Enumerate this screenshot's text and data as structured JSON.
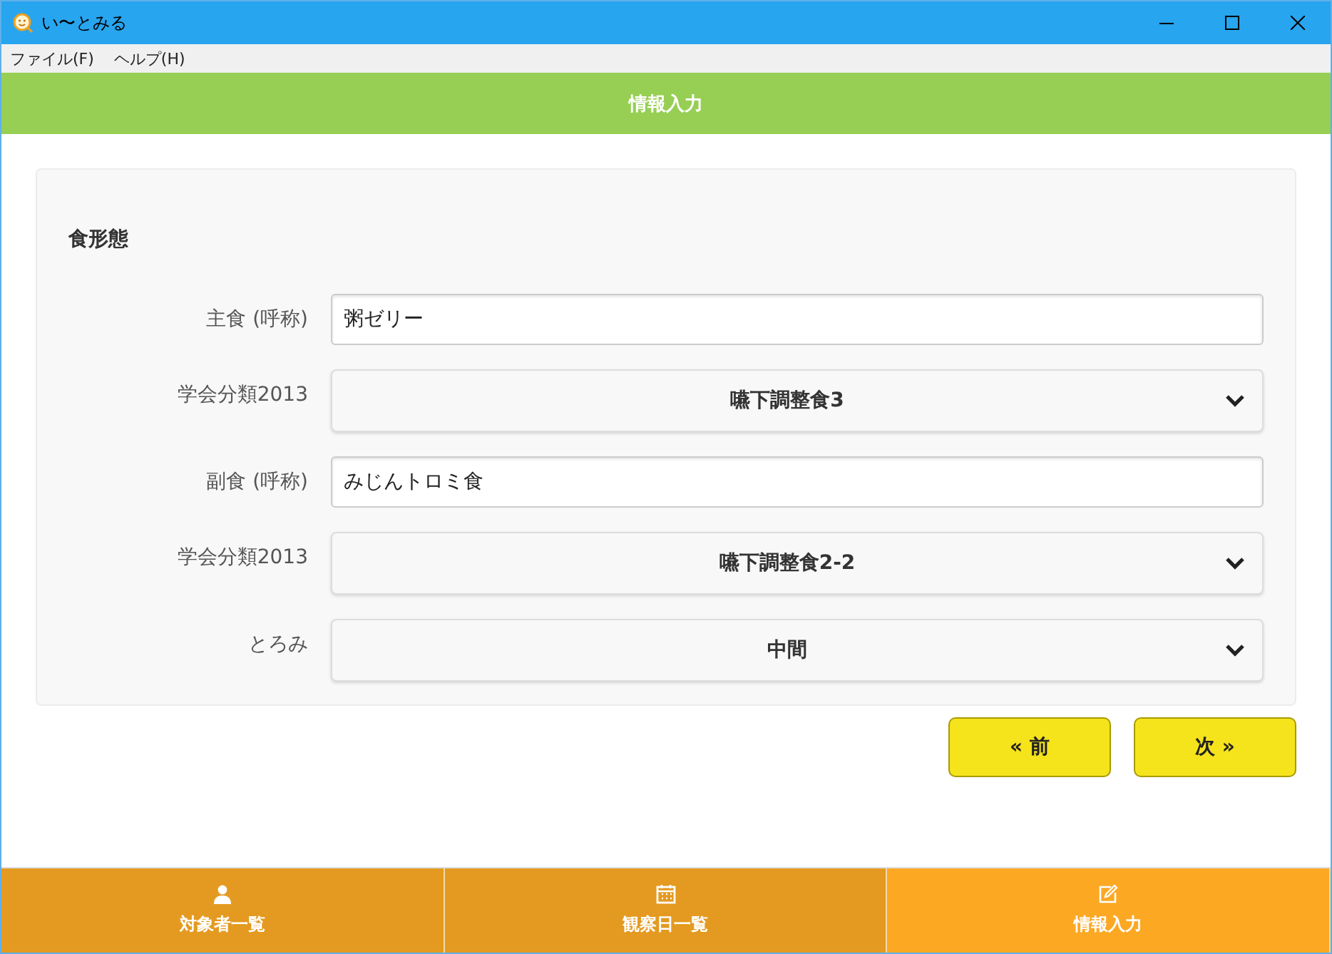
{
  "window": {
    "title": "い〜とみる"
  },
  "menu": [
    "ファイル(F)",
    "ヘルプ(H)"
  ],
  "header": {
    "title": "情報入力"
  },
  "section": {
    "title": "食形態",
    "fields": [
      {
        "kind": "text",
        "label": "主食 (呼称)",
        "value": "粥ゼリー"
      },
      {
        "kind": "select",
        "label": "学会分類2013",
        "value": "嚥下調整食3"
      },
      {
        "kind": "text",
        "label": "副食 (呼称)",
        "value": "みじんトロミ食"
      },
      {
        "kind": "select",
        "label": "学会分類2013",
        "value": "嚥下調整食2-2"
      },
      {
        "kind": "select",
        "label": "とろみ",
        "value": "中間"
      }
    ]
  },
  "buttons": [
    {
      "label": "« 前"
    },
    {
      "label": "次 »"
    }
  ],
  "nav": [
    {
      "kind": "person",
      "label": "対象者一覧",
      "selected": false
    },
    {
      "kind": "calendar",
      "label": "観察日一覧",
      "selected": false
    },
    {
      "kind": "edit",
      "label": "情報入力",
      "selected": true
    }
  ]
}
